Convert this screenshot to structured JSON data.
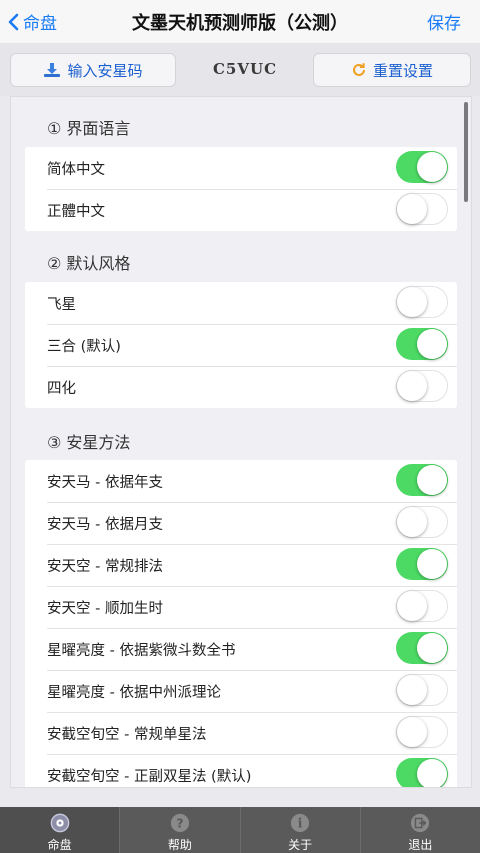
{
  "nav": {
    "back_label": "命盘",
    "title": "文墨天机预测师版（公测）",
    "save_label": "保存"
  },
  "toolbar": {
    "install_label": "输入安星码",
    "code": "C5VUC",
    "reset_label": "重置设置"
  },
  "colors": {
    "accent": "#1a7cf5",
    "toggle_on": "#4cd964",
    "tabbar": "#5a5a5a"
  },
  "sections": [
    {
      "title": "① 界面语言",
      "items": [
        {
          "label": "简体中文",
          "on": true
        },
        {
          "label": "正體中文",
          "on": false
        }
      ]
    },
    {
      "title": "② 默认风格",
      "items": [
        {
          "label": "飞星",
          "on": false
        },
        {
          "label": "三合 (默认)",
          "on": true
        },
        {
          "label": "四化",
          "on": false
        }
      ]
    },
    {
      "title": "③ 安星方法",
      "items": [
        {
          "label": "安天马 - 依据年支",
          "on": true
        },
        {
          "label": "安天马 - 依据月支",
          "on": false
        },
        {
          "label": "安天空 - 常规排法",
          "on": true
        },
        {
          "label": "安天空 - 顺加生时",
          "on": false
        },
        {
          "label": "星曜亮度 - 依据紫微斗数全书",
          "on": true
        },
        {
          "label": "星曜亮度 - 依据中州派理论",
          "on": false
        },
        {
          "label": "安截空旬空 - 常规单星法",
          "on": false
        },
        {
          "label": "安截空旬空 - 正副双星法 (默认)",
          "on": true
        }
      ]
    }
  ],
  "tabs": [
    {
      "label": "命盘",
      "icon": "disc-icon"
    },
    {
      "label": "帮助",
      "icon": "question-icon"
    },
    {
      "label": "关于",
      "icon": "info-icon"
    },
    {
      "label": "退出",
      "icon": "exit-icon"
    }
  ]
}
